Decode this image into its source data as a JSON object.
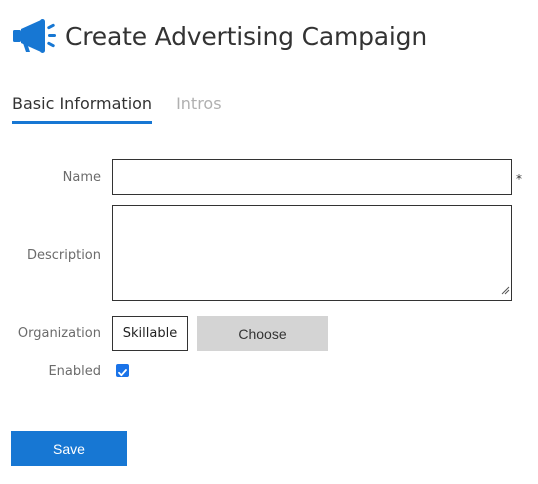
{
  "header": {
    "title": "Create Advertising Campaign",
    "icon": "megaphone-icon",
    "icon_color": "#1777d3"
  },
  "tabs": [
    {
      "label": "Basic Information",
      "active": true
    },
    {
      "label": "Intros",
      "active": false
    }
  ],
  "form": {
    "name": {
      "label": "Name",
      "value": "",
      "required_marker": "*"
    },
    "description": {
      "label": "Description",
      "value": ""
    },
    "organization": {
      "label": "Organization",
      "value": "Skillable",
      "choose_label": "Choose"
    },
    "enabled": {
      "label": "Enabled",
      "checked": true
    }
  },
  "actions": {
    "save_label": "Save"
  },
  "colors": {
    "accent": "#1777d3",
    "checkbox": "#1a73e8",
    "choose_bg": "#d4d4d4"
  }
}
